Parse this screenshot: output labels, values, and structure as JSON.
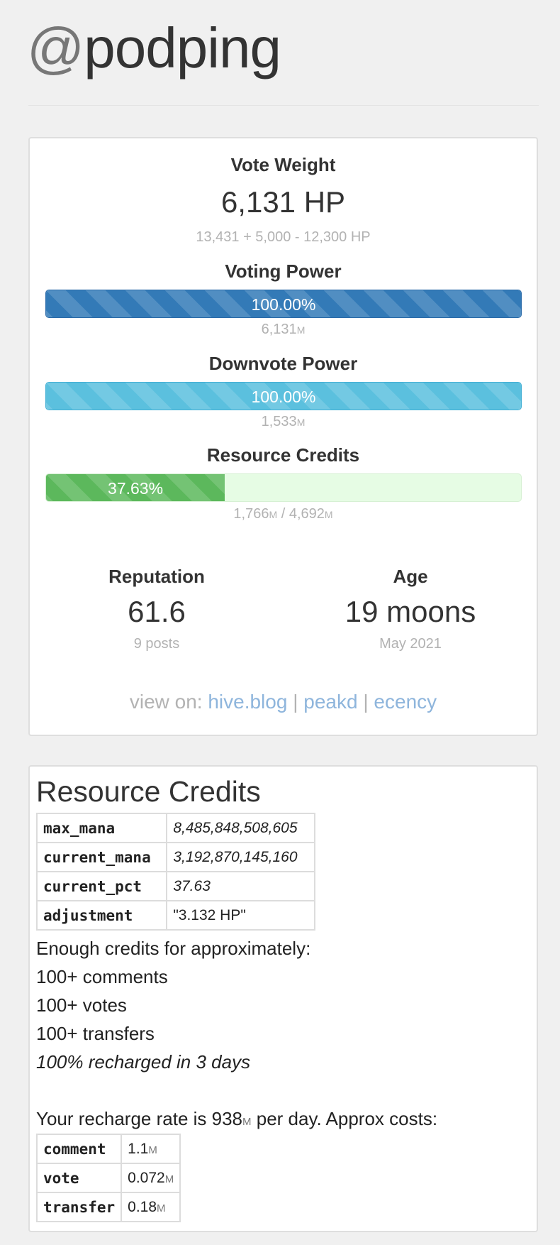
{
  "account": {
    "at": "@",
    "name": "podping"
  },
  "vote_weight": {
    "heading": "Vote Weight",
    "value": "6,131 HP",
    "breakdown": "13,431 + 5,000 - 12,300 HP"
  },
  "voting_power": {
    "heading": "Voting Power",
    "pct": 100.0,
    "pct_label": "100.00%",
    "mana": "6,131",
    "unit": "M"
  },
  "downvote_power": {
    "heading": "Downvote Power",
    "pct": 100.0,
    "pct_label": "100.00%",
    "mana": "1,533",
    "unit": "M"
  },
  "resource_credits_bar": {
    "heading": "Resource Credits",
    "pct": 37.63,
    "pct_label": "37.63%",
    "current": "1,766",
    "max": "4,692",
    "unit": "M",
    "sep": "/"
  },
  "reputation": {
    "heading": "Reputation",
    "value": "61.6",
    "sub": "9 posts"
  },
  "age": {
    "heading": "Age",
    "value": "19 moons",
    "sub": "May 2021"
  },
  "view_on": {
    "prefix": "view on:",
    "sep": "|",
    "links": [
      "hive.blog",
      "peakd",
      "ecency"
    ]
  },
  "rc": {
    "title": "Resource Credits",
    "rows": [
      {
        "key": "max_mana",
        "value": "8,485,848,508,605"
      },
      {
        "key": "current_mana",
        "value": "3,192,870,145,160"
      },
      {
        "key": "current_pct",
        "value": "37.63"
      },
      {
        "key": "adjustment",
        "value": "\"3.132 HP\""
      }
    ],
    "enough": "Enough credits for approximately:",
    "comments": "100+ comments",
    "votes": "100+ votes",
    "transfers": "100+ transfers",
    "recharged": "100% recharged in 3 days",
    "rate_prefix": "Your recharge rate is 938",
    "rate_unit": "M",
    "rate_suffix": " per day. Approx costs:",
    "costs": [
      {
        "key": "comment",
        "value": "1.1",
        "unit": "M"
      },
      {
        "key": "vote",
        "value": "0.072",
        "unit": "M"
      },
      {
        "key": "transfer",
        "value": "0.18",
        "unit": "M"
      }
    ]
  },
  "colors": {
    "voting_bar": "#337ab7",
    "downvote_bar": "#5bc0de",
    "rc_bar": "#5cb85c",
    "rc_bar_bg": "#e6fce4",
    "link": "#8eb5dc"
  }
}
